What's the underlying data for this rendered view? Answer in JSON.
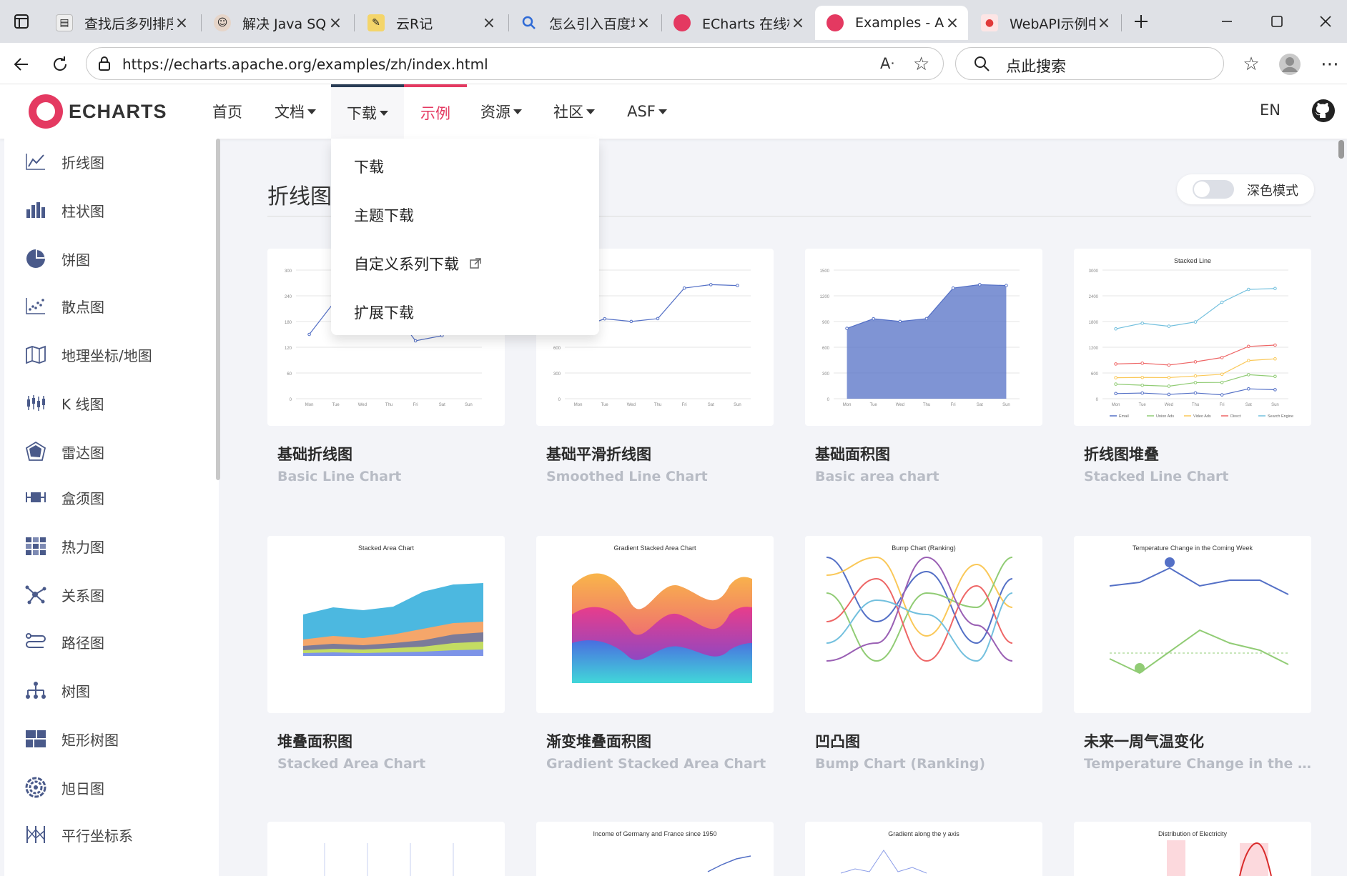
{
  "browser": {
    "tabs": [
      {
        "title": "查找后多列排序",
        "favicon": "doc-icon"
      },
      {
        "title": "解决 Java SQL 注入",
        "favicon": "avatar-icon"
      },
      {
        "title": "云R记",
        "favicon": "pen-icon"
      },
      {
        "title": "怎么引入百度地图",
        "favicon": "search-icon"
      },
      {
        "title": "ECharts 在线构建",
        "favicon": "echarts-icon"
      },
      {
        "title": "Examples - Apache ECharts",
        "favicon": "echarts-icon"
      },
      {
        "title": "WebAPI示例中心",
        "favicon": "map-pin-icon"
      }
    ],
    "active_tab": 5,
    "url": "https://echarts.apache.org/examples/zh/index.html",
    "search_placeholder": "点此搜索"
  },
  "site": {
    "logo_text": "ECHARTS",
    "nav": [
      {
        "label": "首页"
      },
      {
        "label": "文档"
      },
      {
        "label": "下载"
      },
      {
        "label": "示例"
      },
      {
        "label": "资源"
      },
      {
        "label": "社区"
      },
      {
        "label": "ASF"
      }
    ],
    "lang": "EN",
    "download_menu": [
      "下载",
      "主题下载",
      "自定义系列下载",
      "扩展下载"
    ],
    "accent_color": "#e43961"
  },
  "sidebar": {
    "items": [
      {
        "label": "折线图",
        "icon": "line-chart-icon"
      },
      {
        "label": "柱状图",
        "icon": "bar-chart-icon"
      },
      {
        "label": "饼图",
        "icon": "pie-chart-icon"
      },
      {
        "label": "散点图",
        "icon": "scatter-icon"
      },
      {
        "label": "地理坐标/地图",
        "icon": "map-icon"
      },
      {
        "label": "K 线图",
        "icon": "candlestick-icon"
      },
      {
        "label": "雷达图",
        "icon": "radar-icon"
      },
      {
        "label": "盒须图",
        "icon": "boxplot-icon"
      },
      {
        "label": "热力图",
        "icon": "heatmap-icon"
      },
      {
        "label": "关系图",
        "icon": "graph-icon"
      },
      {
        "label": "路径图",
        "icon": "lines-icon"
      },
      {
        "label": "树图",
        "icon": "tree-icon"
      },
      {
        "label": "矩形树图",
        "icon": "treemap-icon"
      },
      {
        "label": "旭日图",
        "icon": "sunburst-icon"
      },
      {
        "label": "平行坐标系",
        "icon": "parallel-icon"
      }
    ]
  },
  "main": {
    "section_title": "折线图",
    "dark_mode_label": "深色模式",
    "cards": [
      {
        "zh": "基础折线图",
        "en": "Basic Line Chart",
        "thumb_title": ""
      },
      {
        "zh": "基础平滑折线图",
        "en": "Smoothed Line Chart",
        "thumb_title": ""
      },
      {
        "zh": "基础面积图",
        "en": "Basic area chart",
        "thumb_title": ""
      },
      {
        "zh": "折线图堆叠",
        "en": "Stacked Line Chart",
        "thumb_title": "Stacked Line"
      },
      {
        "zh": "堆叠面积图",
        "en": "Stacked Area Chart",
        "thumb_title": "Stacked Area Chart"
      },
      {
        "zh": "渐变堆叠面积图",
        "en": "Gradient Stacked Area Chart",
        "thumb_title": "Gradient Stacked Area Chart"
      },
      {
        "zh": "凹凸图",
        "en": "Bump Chart (Ranking)",
        "thumb_title": "Bump Chart (Ranking)"
      },
      {
        "zh": "未来一周气温变化",
        "en": "Temperature Change in the Coming Week",
        "thumb_title": "Temperature Change in the Coming Week"
      },
      {
        "zh": "",
        "en": "",
        "thumb_title": ""
      },
      {
        "zh": "",
        "en": "",
        "thumb_title": "Income of Germany and France since 1950"
      },
      {
        "zh": "",
        "en": "",
        "thumb_title": "Gradient along the y axis"
      },
      {
        "zh": "",
        "en": "",
        "thumb_title": "Distribution of Electricity"
      }
    ]
  },
  "chart_data": [
    {
      "type": "line",
      "categories": [
        "Mon",
        "Tue",
        "Wed",
        "Thu",
        "Fri",
        "Sat",
        "Sun"
      ],
      "values": [
        150,
        230,
        224,
        218,
        135,
        147,
        260
      ],
      "ylim": [
        0,
        300
      ]
    },
    {
      "type": "line",
      "categories": [
        "Mon",
        "Tue",
        "Wed",
        "Thu",
        "Fri",
        "Sat",
        "Sun"
      ],
      "values": [
        820,
        932,
        901,
        934,
        1290,
        1330,
        1320
      ],
      "ylim": [
        0,
        1500
      ]
    },
    {
      "type": "area",
      "categories": [
        "Mon",
        "Tue",
        "Wed",
        "Thu",
        "Fri",
        "Sat",
        "Sun"
      ],
      "values": [
        820,
        932,
        901,
        934,
        1290,
        1330,
        1320
      ],
      "ylim": [
        0,
        1500
      ]
    },
    {
      "type": "line",
      "title": "Stacked Line",
      "categories": [
        "Mon",
        "Tue",
        "Wed",
        "Thu",
        "Fri",
        "Sat",
        "Sun"
      ],
      "series": [
        {
          "name": "Email",
          "values": [
            120,
            132,
            101,
            134,
            90,
            230,
            210
          ]
        },
        {
          "name": "Union Ads",
          "values": [
            340,
            314,
            292,
            376,
            380,
            560,
            520
          ]
        },
        {
          "name": "Video Ads",
          "values": [
            490,
            496,
            493,
            530,
            570,
            890,
            930
          ]
        },
        {
          "name": "Direct",
          "values": [
            810,
            828,
            785,
            860,
            960,
            1220,
            1250
          ]
        },
        {
          "name": "Search Engine",
          "values": [
            1630,
            1760,
            1690,
            1790,
            2250,
            2550,
            2570
          ]
        }
      ],
      "ylim": [
        0,
        3000
      ]
    }
  ]
}
